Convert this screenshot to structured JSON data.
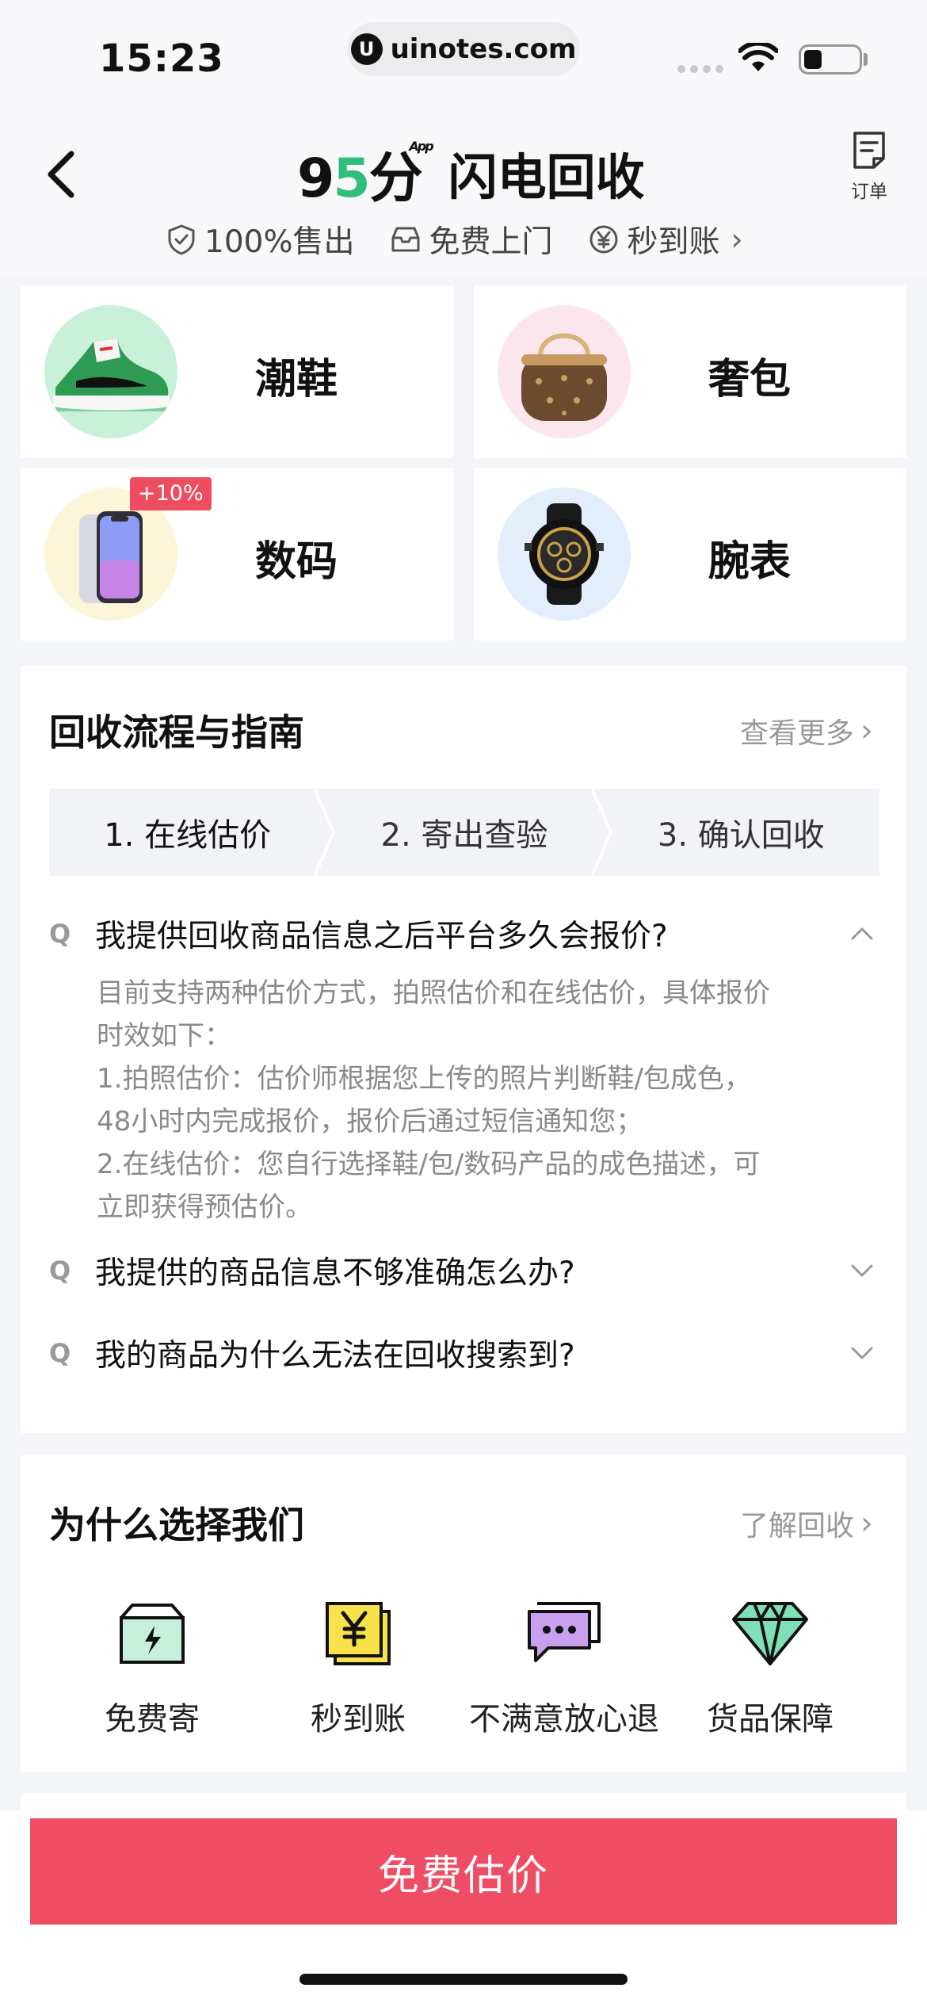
{
  "status_bar": {
    "time": "15:23",
    "url": "uinotes.com"
  },
  "header": {
    "brand_logo": "95分",
    "brand_logo_prefix": "9",
    "brand_logo_five": "5",
    "brand_logo_suffix": "分",
    "brand_app": "App",
    "title": "闪电回收",
    "orders_label": "订单",
    "features": [
      "100%售出",
      "免费上门",
      "秒到账"
    ]
  },
  "categories": [
    {
      "label": "潮鞋",
      "icon": "sneaker-icon"
    },
    {
      "label": "奢包",
      "icon": "handbag-icon"
    },
    {
      "label": "数码",
      "icon": "phone-icon",
      "badge": "+10%"
    },
    {
      "label": "腕表",
      "icon": "watch-icon"
    }
  ],
  "guide": {
    "title": "回收流程与指南",
    "more": "查看更多",
    "steps": [
      "1. 在线估价",
      "2. 寄出查验",
      "3. 确认回收"
    ],
    "faq_mark": "Q",
    "faqs": [
      {
        "question": "我提供回收商品信息之后平台多久会报价?",
        "expanded": true,
        "answer_lines": [
          "目前支持两种估价方式，拍照估价和在线估价，具体报价",
          "时效如下：",
          "1.拍照估价：估价师根据您上传的照片判断鞋/包成色，",
          "48小时内完成报价，报价后通过短信通知您；",
          "2.在线估价：您自行选择鞋/包/数码产品的成色描述，可",
          "立即获得预估价。"
        ]
      },
      {
        "question": "我提供的商品信息不够准确怎么办?",
        "expanded": false
      },
      {
        "question": "我的商品为什么无法在回收搜索到?",
        "expanded": false
      }
    ]
  },
  "why": {
    "title": "为什么选择我们",
    "more": "了解回收",
    "items": [
      {
        "label": "免费寄",
        "icon": "box-icon"
      },
      {
        "label": "秒到账",
        "icon": "yen-icon"
      },
      {
        "label": "不满意放心退",
        "icon": "chat-icon"
      },
      {
        "label": "货品保障",
        "icon": "diamond-icon"
      }
    ]
  },
  "cta": {
    "label": "免费估价"
  },
  "colors": {
    "accent": "#ee4d64",
    "brand_green": "#2fbf7a",
    "page_bg": "#f4f5f9"
  }
}
